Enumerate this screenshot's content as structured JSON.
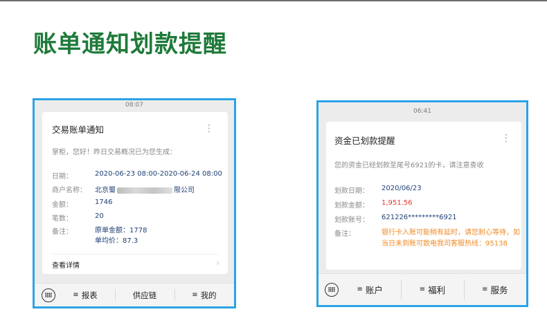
{
  "heading": "账单通知划款提醒",
  "left": {
    "time": "08:07",
    "title": "交易账单通知",
    "greeting": "掌柜，您好！昨日交易概况已为您生成：",
    "rows": {
      "date": {
        "label": "日期：",
        "value": "2020-06-23 08:00-2020-06-24 08:00"
      },
      "merchant": {
        "label": "商户名称：",
        "prefix": "北京蜀",
        "suffix": "限公司"
      },
      "amount": {
        "label": "金额：",
        "value": "1746"
      },
      "count": {
        "label": "笔数：",
        "value": "20"
      },
      "note": {
        "label": "备注：",
        "line1": "原单金额：1778",
        "line2": "单均价：87.3"
      }
    },
    "detail_label": "查看详情",
    "chevron": "›",
    "menu": {
      "item1": "报表",
      "item2": "供应链",
      "item3": "我的"
    }
  },
  "right": {
    "time": "06:41",
    "title": "资金已划款提醒",
    "greeting": "您的资金已经划款至尾号6921的卡，请注意查收",
    "rows": {
      "date": {
        "label": "划款日期：",
        "value": "2020/06/23"
      },
      "amount": {
        "label": "划款金额：",
        "value": "1,951.56"
      },
      "account": {
        "label": "划款账号：",
        "value": "621226*********6921"
      },
      "note": {
        "label": "备注：",
        "value": "银行卡入账可能稍有延时，请您耐心等待，如当日未到账可致电我司客服热线：95138"
      }
    },
    "menu": {
      "item1": "账户",
      "item2": "福利",
      "item3": "服务"
    }
  },
  "menu_glyph": "≡",
  "more_glyph": "⋮",
  "colors": {
    "heading": "#1f7a3a",
    "frame": "#2aa3e6",
    "value": "#1f3f75",
    "amount_red": "#e0392e",
    "note_orange": "#f08a24"
  }
}
